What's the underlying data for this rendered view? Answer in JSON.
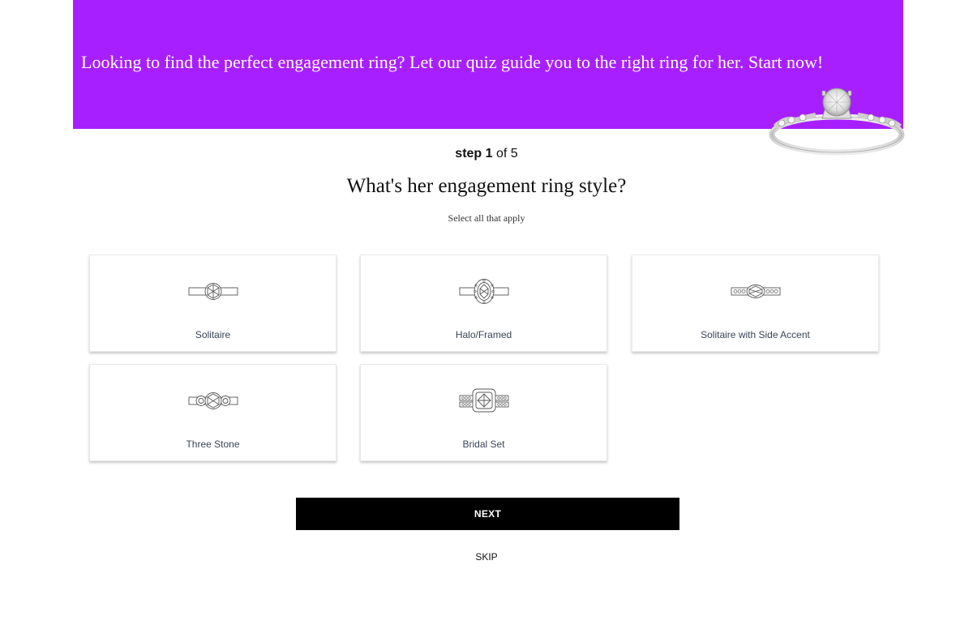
{
  "banner": {
    "text": "Looking to find the perfect engagement ring? Let our quiz guide you to the right ring for her. Start now!",
    "background": "#a81fff",
    "image": "engagement-ring-photo"
  },
  "progress": {
    "step_word": "step",
    "current": "1",
    "of_text": "of 5"
  },
  "question": {
    "title": "What's her engagement ring style?",
    "subtitle": "Select all that apply"
  },
  "options": [
    {
      "label": "Solitaire",
      "icon": "solitaire-ring-icon"
    },
    {
      "label": "Halo/Framed",
      "icon": "halo-ring-icon"
    },
    {
      "label": "Solitaire with Side Accent",
      "icon": "side-accent-ring-icon"
    },
    {
      "label": "Three Stone",
      "icon": "three-stone-ring-icon"
    },
    {
      "label": "Bridal Set",
      "icon": "bridal-set-ring-icon"
    }
  ],
  "actions": {
    "next_label": "NEXT",
    "skip_label": "SKIP"
  }
}
